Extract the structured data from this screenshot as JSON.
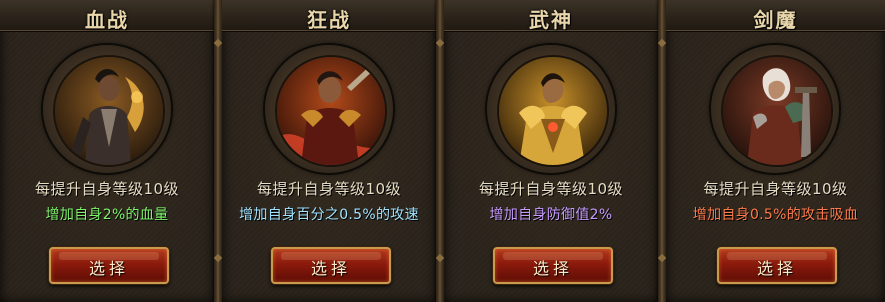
{
  "cards": [
    {
      "title": "血战",
      "level_text": "每提升自身等级10级",
      "bonus_text": "增加自身2%的血量",
      "bonus_color": "#7df26b",
      "button_label": "选择",
      "portrait": "warrior-portrait"
    },
    {
      "title": "狂战",
      "level_text": "每提升自身等级10级",
      "bonus_text": "增加自身百分之0.5%的攻速",
      "bonus_color": "#9fe3ff",
      "button_label": "选择",
      "portrait": "berserker-portrait"
    },
    {
      "title": "武神",
      "level_text": "每提升自身等级10级",
      "bonus_text": "增加自身防御值2%",
      "bonus_color": "#c79bff",
      "button_label": "选择",
      "portrait": "war-god-portrait"
    },
    {
      "title": "剑魔",
      "level_text": "每提升自身等级10级",
      "bonus_text": "增加自身0.5%的攻击吸血",
      "bonus_color": "#ff7a4a",
      "button_label": "选择",
      "portrait": "sword-demon-portrait"
    }
  ]
}
